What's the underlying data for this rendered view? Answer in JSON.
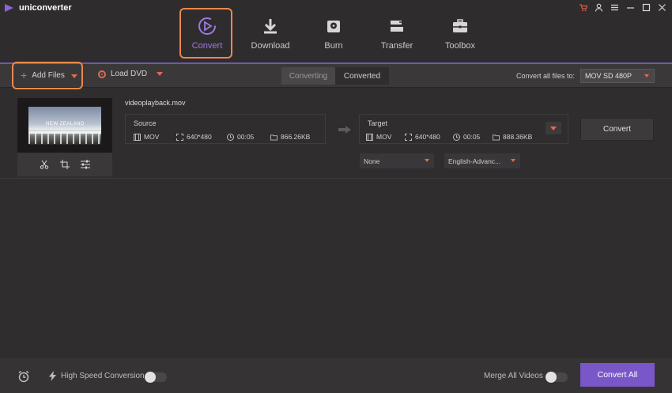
{
  "app": {
    "title": "uniconverter"
  },
  "nav": {
    "items": [
      {
        "label": "Convert",
        "icon": "convert-icon",
        "active": true
      },
      {
        "label": "Download",
        "icon": "download-icon",
        "active": false
      },
      {
        "label": "Burn",
        "icon": "burn-icon",
        "active": false
      },
      {
        "label": "Transfer",
        "icon": "transfer-icon",
        "active": false
      },
      {
        "label": "Toolbox",
        "icon": "toolbox-icon",
        "active": false
      }
    ]
  },
  "toolbar": {
    "add_files": "Add Files",
    "load_dvd": "Load DVD",
    "tab_converting": "Converting",
    "tab_converted": "Converted",
    "convert_all_to_label": "Convert all files to:",
    "format_value": "MOV SD 480P"
  },
  "file": {
    "name": "videoplayback.mov",
    "thumb_overlay": "NEW ZEALAND",
    "source": {
      "title": "Source",
      "format": "MOV",
      "resolution": "640*480",
      "duration": "00:05",
      "size": "866.26KB"
    },
    "target": {
      "title": "Target",
      "format": "MOV",
      "resolution": "640*480",
      "duration": "00:05",
      "size": "888.36KB"
    },
    "convert_label": "Convert",
    "subtitle_value": "None",
    "audio_value": "English-Advanc..."
  },
  "bottom": {
    "high_speed_label": "High Speed Conversion",
    "merge_label": "Merge All Videos",
    "convert_all_label": "Convert All"
  },
  "colors": {
    "accent": "#7a57c8",
    "highlight": "#e9884b",
    "orange_icon": "#e06b4e",
    "background": "#302d2f"
  }
}
